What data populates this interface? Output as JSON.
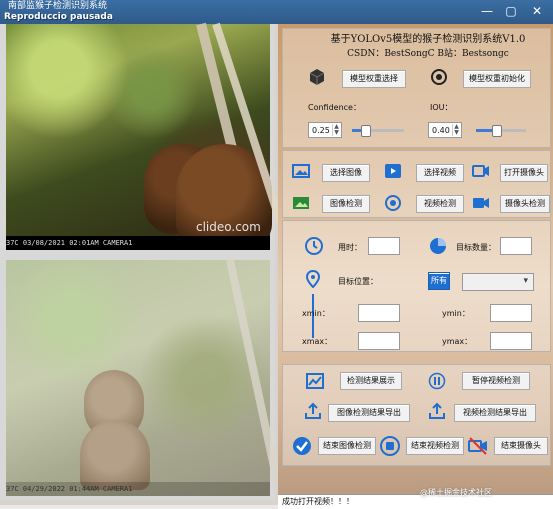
{
  "window": {
    "title": "南部监猴子检测识别系统",
    "recording_label": "Reproduccio pausada",
    "controls": {
      "minimize": "—",
      "maximize": "▢",
      "close": "✕"
    }
  },
  "videos": {
    "top_caption": "37C    03/08/2021    02:01AM    CAMERA1",
    "top_watermark": "clideo.com",
    "bottom_caption": "37C    04/29/2022    01:44AM    CAMERA1"
  },
  "app": {
    "title": "基于YOLOv5模型的猴子检测识别系统V1.0",
    "credits": "CSDN：BestSongC    B站：Bestsongc"
  },
  "model": {
    "select_weights": "模型权重选择",
    "init_weights": "模型权重初始化"
  },
  "params": {
    "confidence_label": "Confidence：",
    "confidence_value": "0.25",
    "confidence_level": 0.25,
    "iou_label": "IOU：",
    "iou_value": "0.40",
    "iou_level": 0.4
  },
  "inputs": {
    "select_image": "选择图像",
    "select_video": "选择视频",
    "open_camera": "打开摄像头",
    "image_detect": "图像检测",
    "video_detect": "视频检测",
    "camera_detect": "摄像头检测"
  },
  "results": {
    "time_label": "用时：",
    "target_count_label": "目标数量：",
    "target_position_label": "目标位置：",
    "xmin_label": "xmin：",
    "ymin_label": "ymin：",
    "xmax_label": "xmax：",
    "ymax_label": "ymax：",
    "all_label": "所有"
  },
  "actions": {
    "show_results": "检测结果展示",
    "pause_video": "暂停视频检测",
    "export_image_results": "图像检测结果导出",
    "export_video_results": "视频检测结果导出",
    "end_image_detect": "结束图像检测",
    "end_video_detect": "结束视频检测",
    "end_camera": "结束摄像头"
  },
  "status": {
    "message": "成功打开视频！！！"
  },
  "footer": {
    "watermark": "@稀土掘金技术社区"
  },
  "colors": {
    "accent": "#3f7bd6",
    "titlebar": "#2f5a8a"
  }
}
